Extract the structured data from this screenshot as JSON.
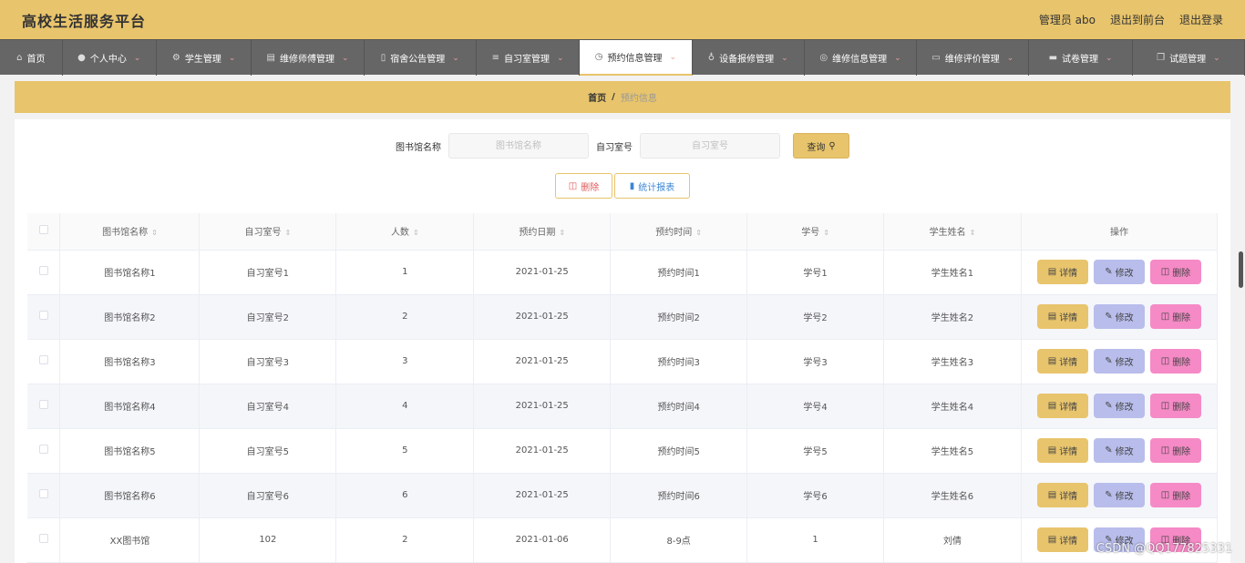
{
  "header": {
    "brand": "高校生活服务平台",
    "user": "管理员 abo",
    "to_front": "退出到前台",
    "logout": "退出登录"
  },
  "nav": [
    {
      "label": "首页",
      "icon": "home-icon",
      "glyph": "⌂",
      "chev": false
    },
    {
      "label": "个人中心",
      "icon": "user-icon",
      "glyph": "●",
      "chev": true
    },
    {
      "label": "学生管理",
      "icon": "gear-icon",
      "glyph": "⚙",
      "chev": true
    },
    {
      "label": "维修师傅管理",
      "icon": "clipboard-icon",
      "glyph": "▤",
      "chev": true
    },
    {
      "label": "宿舍公告管理",
      "icon": "phone-icon",
      "glyph": "▯",
      "chev": true
    },
    {
      "label": "自习室管理",
      "icon": "list-icon",
      "glyph": "≡",
      "chev": true
    },
    {
      "label": "预约信息管理",
      "icon": "clock-icon",
      "glyph": "◷",
      "chev": true,
      "active": true
    },
    {
      "label": "设备报修管理",
      "icon": "mic-icon",
      "glyph": "♁",
      "chev": true
    },
    {
      "label": "维修信息管理",
      "icon": "compass-icon",
      "glyph": "◎",
      "chev": true
    },
    {
      "label": "维修评价管理",
      "icon": "chat-icon",
      "glyph": "▭",
      "chev": true
    },
    {
      "label": "试卷管理",
      "icon": "briefcase-icon",
      "glyph": "▬",
      "chev": true
    },
    {
      "label": "试题管理",
      "icon": "copy-icon",
      "glyph": "❐",
      "chev": true
    }
  ],
  "breadcrumb": {
    "home": "首页",
    "sep": "/",
    "current": "预约信息"
  },
  "search": {
    "label1": "图书馆名称",
    "placeholder1": "图书馆名称",
    "label2": "自习室号",
    "placeholder2": "自习室号",
    "button": "查询"
  },
  "actions": {
    "delete": "删除",
    "report": "统计报表"
  },
  "table": {
    "headers": [
      "图书馆名称",
      "自习室号",
      "人数",
      "预约日期",
      "预约时间",
      "学号",
      "学生姓名",
      "操作"
    ],
    "rows": [
      [
        "图书馆名称1",
        "自习室号1",
        "1",
        "2021-01-25",
        "预约时间1",
        "学号1",
        "学生姓名1"
      ],
      [
        "图书馆名称2",
        "自习室号2",
        "2",
        "2021-01-25",
        "预约时间2",
        "学号2",
        "学生姓名2"
      ],
      [
        "图书馆名称3",
        "自习室号3",
        "3",
        "2021-01-25",
        "预约时间3",
        "学号3",
        "学生姓名3"
      ],
      [
        "图书馆名称4",
        "自习室号4",
        "4",
        "2021-01-25",
        "预约时间4",
        "学号4",
        "学生姓名4"
      ],
      [
        "图书馆名称5",
        "自习室号5",
        "5",
        "2021-01-25",
        "预约时间5",
        "学号5",
        "学生姓名5"
      ],
      [
        "图书馆名称6",
        "自习室号6",
        "6",
        "2021-01-25",
        "预约时间6",
        "学号6",
        "学生姓名6"
      ],
      [
        "XX图书馆",
        "102",
        "2",
        "2021-01-06",
        "8-9点",
        "1",
        "刘倩"
      ]
    ],
    "op_detail": "详情",
    "op_edit": "修改",
    "op_delete": "删除"
  },
  "watermark": "CSDN @QQ177825331",
  "colors": {
    "accent": "#e8c46c",
    "nav_bg": "#666666",
    "edit": "#b8bdeb",
    "delete": "#f58ac6"
  }
}
